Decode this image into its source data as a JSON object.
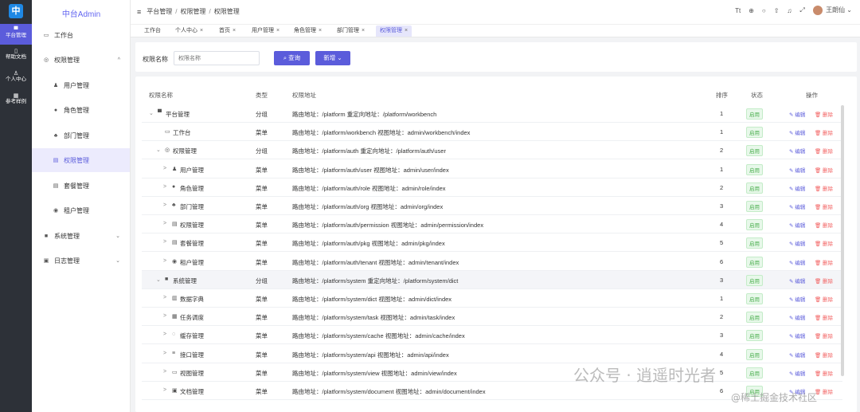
{
  "rail": {
    "logo": "中",
    "items": [
      {
        "label": "平台管理",
        "icon": "monitor-icon",
        "glyph": "▀"
      },
      {
        "label": "帮助文档",
        "icon": "doc-icon",
        "glyph": "▯"
      },
      {
        "label": "个人中心",
        "icon": "user-icon",
        "glyph": "♙"
      },
      {
        "label": "参考样例",
        "icon": "grid-icon",
        "glyph": "▦"
      }
    ]
  },
  "sidebar": {
    "title": "中台Admin",
    "items": [
      {
        "label": "工作台",
        "glyph": "▭",
        "arrow": ""
      },
      {
        "label": "权限管理",
        "glyph": "◎",
        "arrow": "^"
      },
      {
        "label": "用户管理",
        "glyph": "♟",
        "arrow": ""
      },
      {
        "label": "角色管理",
        "glyph": "●",
        "arrow": ""
      },
      {
        "label": "部门管理",
        "glyph": "♣",
        "arrow": ""
      },
      {
        "label": "权限管理",
        "glyph": "▤",
        "arrow": ""
      },
      {
        "label": "套餐管理",
        "glyph": "▤",
        "arrow": ""
      },
      {
        "label": "租户管理",
        "glyph": "◉",
        "arrow": ""
      },
      {
        "label": "系统管理",
        "glyph": "■",
        "arrow": "⌄"
      },
      {
        "label": "日志管理",
        "glyph": "▣",
        "arrow": "⌄"
      }
    ]
  },
  "header": {
    "breadcrumb": [
      "平台管理",
      "权限管理",
      "权限管理"
    ],
    "menu_glyph": "≡",
    "sep": "/",
    "icons": [
      "Tt",
      "⊕",
      "○",
      "⇧",
      "♫",
      "⤢"
    ],
    "user_name": "王朗仙",
    "user_caret": "⌄"
  },
  "tabs": [
    {
      "label": "工作台",
      "close": ""
    },
    {
      "label": "个人中心",
      "close": "×"
    },
    {
      "label": "首页",
      "close": "×"
    },
    {
      "label": "用户管理",
      "close": "×"
    },
    {
      "label": "角色管理",
      "close": "×"
    },
    {
      "label": "部门管理",
      "close": "×"
    },
    {
      "label": "权限管理",
      "close": "×"
    }
  ],
  "search": {
    "label": "权限名称",
    "placeholder": "权限名称",
    "query_button": "⌕ 查询",
    "add_button": "新增 ⌄"
  },
  "table": {
    "headers": [
      "权限名称",
      "类型",
      "权限地址",
      "排序",
      "状态",
      "操作"
    ],
    "edit_label": "✎ 编辑",
    "delete_label": "🗑 删除",
    "rows": [
      {
        "caret": "⌄",
        "glyph": "▀",
        "name": "平台管理",
        "type": "分组",
        "address": "路由地址：/platform 重定向地址：/platform/workbench",
        "sort": "1",
        "status": "启用"
      },
      {
        "caret": "",
        "glyph": "▭",
        "name": "工作台",
        "type": "菜单",
        "address": "路由地址：/platform/workbench 视图地址：admin/workbench/index",
        "sort": "1",
        "status": "启用"
      },
      {
        "caret": "⌄",
        "glyph": "◎",
        "name": "权限管理",
        "type": "分组",
        "address": "路由地址：/platform/auth 重定向地址：/platform/auth/user",
        "sort": "2",
        "status": "启用"
      },
      {
        "caret": ">",
        "glyph": "♟",
        "name": "用户管理",
        "type": "菜单",
        "address": "路由地址：/platform/auth/user 视图地址：admin/user/index",
        "sort": "1",
        "status": "启用"
      },
      {
        "caret": ">",
        "glyph": "●",
        "name": "角色管理",
        "type": "菜单",
        "address": "路由地址：/platform/auth/role 视图地址：admin/role/index",
        "sort": "2",
        "status": "启用"
      },
      {
        "caret": ">",
        "glyph": "♣",
        "name": "部门管理",
        "type": "菜单",
        "address": "路由地址：/platform/auth/org 视图地址：admin/org/index",
        "sort": "3",
        "status": "启用"
      },
      {
        "caret": ">",
        "glyph": "▤",
        "name": "权限管理",
        "type": "菜单",
        "address": "路由地址：/platform/auth/permission 视图地址：admin/permission/index",
        "sort": "4",
        "status": "启用"
      },
      {
        "caret": ">",
        "glyph": "▤",
        "name": "套餐管理",
        "type": "菜单",
        "address": "路由地址：/platform/auth/pkg 视图地址：admin/pkg/index",
        "sort": "5",
        "status": "启用"
      },
      {
        "caret": ">",
        "glyph": "◉",
        "name": "租户管理",
        "type": "菜单",
        "address": "路由地址：/platform/auth/tenant 视图地址：admin/tenant/index",
        "sort": "6",
        "status": "启用"
      },
      {
        "caret": "⌄",
        "glyph": "■",
        "name": "系统管理",
        "type": "分组",
        "address": "路由地址：/platform/system 重定向地址：/platform/system/dict",
        "sort": "3",
        "status": "启用"
      },
      {
        "caret": ">",
        "glyph": "▥",
        "name": "数据字典",
        "type": "菜单",
        "address": "路由地址：/platform/system/dict 视图地址：admin/dict/index",
        "sort": "1",
        "status": "启用"
      },
      {
        "caret": ">",
        "glyph": "▦",
        "name": "任务调度",
        "type": "菜单",
        "address": "路由地址：/platform/system/task 视图地址：admin/task/index",
        "sort": "2",
        "status": "启用"
      },
      {
        "caret": ">",
        "glyph": "◌",
        "name": "缓存管理",
        "type": "菜单",
        "address": "路由地址：/platform/system/cache 视图地址：admin/cache/index",
        "sort": "3",
        "status": "启用"
      },
      {
        "caret": ">",
        "glyph": "≡",
        "name": "接口管理",
        "type": "菜单",
        "address": "路由地址：/platform/system/api 视图地址：admin/api/index",
        "sort": "4",
        "status": "启用"
      },
      {
        "caret": ">",
        "glyph": "▭",
        "name": "视图管理",
        "type": "菜单",
        "address": "路由地址：/platform/system/view 视图地址：admin/view/index",
        "sort": "5",
        "status": "启用"
      },
      {
        "caret": ">",
        "glyph": "▣",
        "name": "文档管理",
        "type": "菜单",
        "address": "路由地址：/platform/system/document 视图地址：admin/document/index",
        "sort": "6",
        "status": "启用"
      }
    ]
  },
  "watermark": {
    "line1": "公众号 · 逍遥时光者",
    "line2": "@稀土掘金技术社区"
  }
}
